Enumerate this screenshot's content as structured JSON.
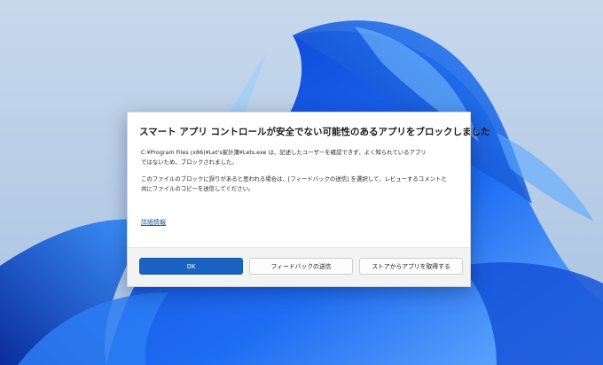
{
  "dialog": {
    "title": "スマート アプリ コントロールが安全でない可能性のあるアプリをブロックしました",
    "message_1_line_1": "C:¥Program Files (x86)¥Let's家計簿¥Lets.exe は、記述したユーザーを確認できず、よく知られているアプリ",
    "message_1_line_2": "ではないため、ブロックされました。",
    "message_2_line_1": "このファイルのブロックに誤りがあると思われる場合は、[フィードバックの送信] を選択して、レビューするコメントと",
    "message_2_line_2": "共にファイルのコピーを送信してください。",
    "details_link": "詳細情報",
    "ok_button": "OK",
    "feedback_button": "フィードバックの送信",
    "store_button": "ストアからアプリを取得する"
  },
  "colors": {
    "desktop_background": "#b7cde6",
    "accent": "#1a63c0",
    "link": "#1e56a8"
  }
}
